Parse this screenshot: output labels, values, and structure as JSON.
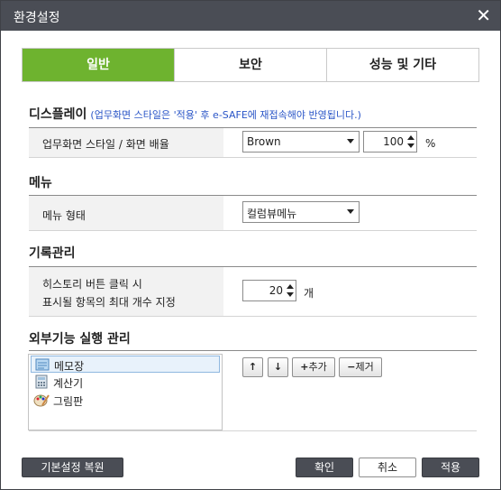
{
  "window": {
    "title": "환경설정",
    "close_label": "✕"
  },
  "tabs": [
    {
      "label": "일반",
      "active": true
    },
    {
      "label": "보안",
      "active": false
    },
    {
      "label": "성능 및 기타",
      "active": false
    }
  ],
  "display": {
    "title": "디스플레이",
    "note": "(업무화면 스타일은 '적용' 후 e-SAFE에 재접속해야 반영됩니다.)",
    "row_label": "업무화면 스타일 / 화면 배율",
    "style_value": "Brown",
    "zoom_value": "100",
    "zoom_unit": "%"
  },
  "menu": {
    "title": "메뉴",
    "row_label": "메뉴 형태",
    "menu_value": "컬럼뷰메뉴"
  },
  "history": {
    "title": "기록관리",
    "row_label_line1": "히스토리 버튼 클릭 시",
    "row_label_line2": "표시될 항목의 최대 개수 지정",
    "count_value": "20",
    "count_unit": "개"
  },
  "external": {
    "title": "외부기능 실행 관리",
    "items": [
      {
        "label": "메모장",
        "icon": "notepad-icon",
        "selected": true
      },
      {
        "label": "계산기",
        "icon": "calculator-icon",
        "selected": false
      },
      {
        "label": "그림판",
        "icon": "paint-icon",
        "selected": false
      }
    ],
    "up_label": "↑",
    "down_label": "↓",
    "add_label": "추가",
    "remove_label": "제거"
  },
  "footer": {
    "restore_label": "기본설정 복원",
    "ok_label": "확인",
    "cancel_label": "취소",
    "apply_label": "적용"
  },
  "colors": {
    "accent": "#6eb32f",
    "titlebar": "#4a4d55",
    "note": "#2a55c7"
  }
}
